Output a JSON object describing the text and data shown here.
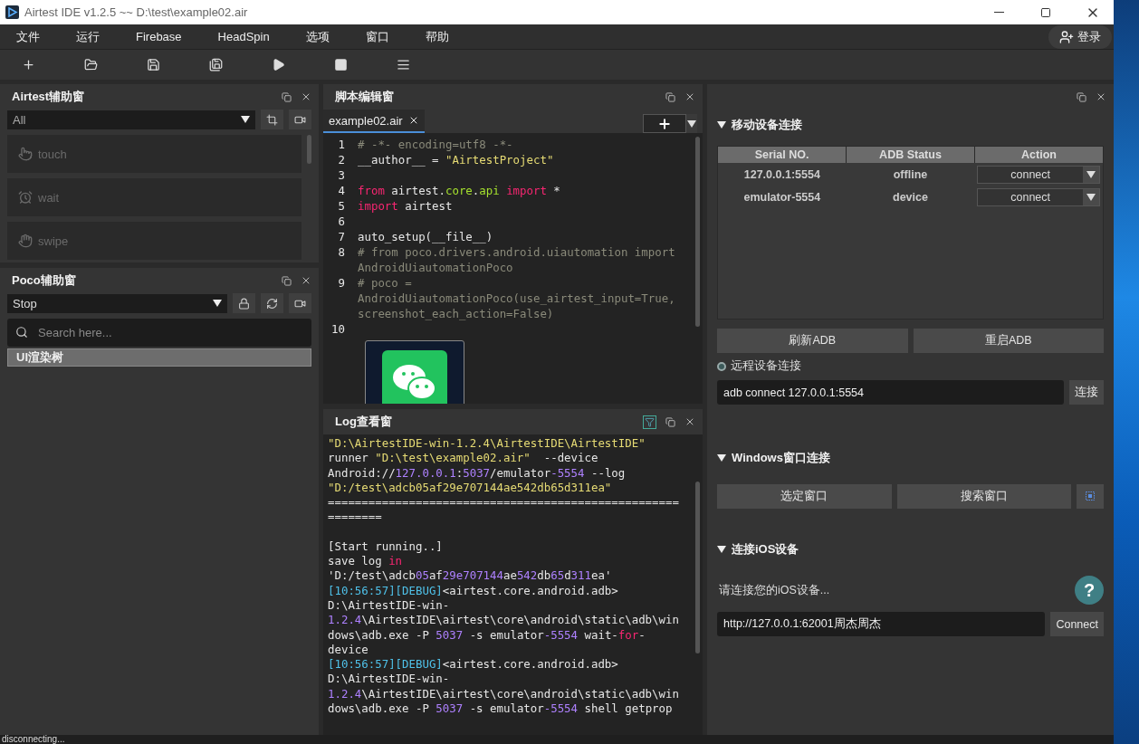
{
  "window": {
    "title": "Airtest IDE v1.2.5 ~~ D:\\test\\example02.air"
  },
  "menu": [
    "文件",
    "运行",
    "Firebase",
    "HeadSpin",
    "选项",
    "窗口",
    "帮助"
  ],
  "login": "登录",
  "airtest_panel": {
    "title": "Airtest辅助窗",
    "filter": "All",
    "actions": [
      {
        "label": "touch",
        "kind": "touch",
        "disabled": true
      },
      {
        "label": "wait",
        "kind": "wait",
        "disabled": true
      },
      {
        "label": "swipe",
        "kind": "swipe",
        "disabled": true
      }
    ]
  },
  "poco_panel": {
    "title": "Poco辅助窗",
    "mode": "Stop",
    "search": {
      "placeholder": "Search here..."
    },
    "tree": [
      {
        "label": "UI渲染树",
        "selected": true
      }
    ]
  },
  "editor": {
    "title": "脚本编辑窗",
    "tabs": [
      {
        "label": "example02.air",
        "selected": true
      }
    ],
    "lines": [
      {
        "number": "1",
        "segments": [
          {
            "text": "# -*- encoding=utf8 -*-",
            "kind": "comment"
          }
        ]
      },
      {
        "number": "2",
        "segments": [
          {
            "text": "__author__ = ",
            "kind": "plain"
          },
          {
            "text": "\"AirtestProject\"",
            "kind": "string"
          }
        ]
      },
      {
        "number": "3"
      },
      {
        "number": "4",
        "segments": [
          {
            "text": "from",
            "kind": "keyword"
          },
          {
            "text": " airtest.",
            "kind": "plain"
          },
          {
            "text": "core",
            "kind": "attr"
          },
          {
            "text": ".",
            "kind": "plain"
          },
          {
            "text": "api",
            "kind": "attr"
          },
          {
            "text": " import",
            "kind": "keyword"
          },
          {
            "text": " *",
            "kind": "plain"
          }
        ]
      },
      {
        "number": "5",
        "segments": [
          {
            "text": "import",
            "kind": "keyword"
          },
          {
            "text": " airtest",
            "kind": "plain"
          }
        ]
      },
      {
        "number": "6"
      },
      {
        "number": "7",
        "segments": [
          {
            "text": "auto_setup(__file__)",
            "kind": "plain"
          }
        ]
      },
      {
        "number": "8",
        "segments": [
          {
            "text": "# from poco.drivers.android.uiautomation import AndroidUiautomationPoco",
            "kind": "comment"
          }
        ]
      },
      {
        "number": "9",
        "segments": [
          {
            "text": "# poco = AndroidUiautomationPoco(use_airtest_input=True, screenshot_each_action=False)",
            "kind": "comment"
          }
        ]
      },
      {
        "number": "10",
        "image": true
      }
    ]
  },
  "log": {
    "title": "Log查看窗",
    "lines": [
      {
        "segments": [
          {
            "text": "\"D:\\AirtestIDE-win-1.2.4\\AirtestIDE\\AirtestIDE\"",
            "kind": "string"
          }
        ]
      },
      {
        "segments": [
          {
            "text": "runner ",
            "kind": "plain"
          },
          {
            "text": "\"D:\\test\\example02.air\"",
            "kind": "string"
          },
          {
            "text": "  --device",
            "kind": "plain"
          }
        ]
      },
      {
        "segments": [
          {
            "text": "Android://",
            "kind": "plain"
          },
          {
            "text": "127.0.0.1",
            "kind": "number"
          },
          {
            "text": ":",
            "kind": "plain"
          },
          {
            "text": "5037",
            "kind": "number"
          },
          {
            "text": "/emulator",
            "kind": "plain"
          },
          {
            "text": "-5554",
            "kind": "number"
          },
          {
            "text": " --log",
            "kind": "plain"
          }
        ]
      },
      {
        "segments": [
          {
            "text": "\"D:/test\\adcb05af29e707144ae542db65d311ea\"",
            "kind": "string"
          }
        ]
      },
      {
        "segments": [
          {
            "text": "====================================================",
            "kind": "plain"
          }
        ]
      },
      {
        "segments": [
          {
            "text": "========",
            "kind": "plain"
          }
        ],
        "blank_after": true
      },
      {
        "segments": [
          {
            "text": "[Start running..]",
            "kind": "plain"
          }
        ]
      },
      {
        "segments": [
          {
            "text": "save log ",
            "kind": "plain"
          },
          {
            "text": "in",
            "kind": "keyword"
          }
        ]
      },
      {
        "segments": [
          {
            "text": "'D:/test\\adcb",
            "kind": "plain"
          },
          {
            "text": "05",
            "kind": "number"
          },
          {
            "text": "af",
            "kind": "plain"
          },
          {
            "text": "29e707144",
            "kind": "number"
          },
          {
            "text": "ae",
            "kind": "plain"
          },
          {
            "text": "542",
            "kind": "number"
          },
          {
            "text": "db",
            "kind": "plain"
          },
          {
            "text": "65",
            "kind": "number"
          },
          {
            "text": "d",
            "kind": "plain"
          },
          {
            "text": "311",
            "kind": "number"
          },
          {
            "text": "ea'",
            "kind": "plain"
          }
        ]
      },
      {
        "segments": [
          {
            "text": "[10:56:57][DEBUG]",
            "kind": "debug"
          },
          {
            "text": "<airtest.core.android.adb>",
            "kind": "plain"
          }
        ]
      },
      {
        "segments": [
          {
            "text": "D:\\AirtestIDE-win-",
            "kind": "plain"
          }
        ]
      },
      {
        "segments": [
          {
            "text": "1.2.4",
            "kind": "number"
          },
          {
            "text": "\\AirtestIDE\\airtest\\core\\android\\static\\adb\\win",
            "kind": "plain"
          }
        ]
      },
      {
        "segments": [
          {
            "text": "dows\\adb.exe -P ",
            "kind": "plain"
          },
          {
            "text": "5037",
            "kind": "number"
          },
          {
            "text": " -s emulator",
            "kind": "plain"
          },
          {
            "text": "-5554",
            "kind": "number"
          },
          {
            "text": " wait-",
            "kind": "plain"
          },
          {
            "text": "for",
            "kind": "keyword"
          },
          {
            "text": "-",
            "kind": "plain"
          }
        ]
      },
      {
        "segments": [
          {
            "text": "device",
            "kind": "plain"
          }
        ]
      },
      {
        "segments": [
          {
            "text": "[10:56:57][DEBUG]",
            "kind": "debug"
          },
          {
            "text": "<airtest.core.android.adb>",
            "kind": "plain"
          }
        ]
      },
      {
        "segments": [
          {
            "text": "D:\\AirtestIDE-win-",
            "kind": "plain"
          }
        ]
      },
      {
        "segments": [
          {
            "text": "1.2.4",
            "kind": "number"
          },
          {
            "text": "\\AirtestIDE\\airtest\\core\\android\\static\\adb\\win",
            "kind": "plain"
          }
        ]
      },
      {
        "segments": [
          {
            "text": "dows\\adb.exe -P ",
            "kind": "plain"
          },
          {
            "text": "5037",
            "kind": "number"
          },
          {
            "text": " -s emulator",
            "kind": "plain"
          },
          {
            "text": "-5554",
            "kind": "number"
          },
          {
            "text": " shell getprop",
            "kind": "plain"
          }
        ]
      }
    ]
  },
  "devices": {
    "title": "移动设备连接",
    "expanded": true,
    "table": {
      "columns": [
        "Serial NO.",
        "ADB Status",
        "Action"
      ],
      "rows": [
        {
          "serial": "127.0.0.1:5554",
          "status": "offline",
          "action": "connect"
        },
        {
          "serial": "emulator-5554",
          "status": "device",
          "action": "connect"
        }
      ]
    },
    "buttons": [
      "刷新ADB",
      "重启ADB"
    ],
    "remote": {
      "label": "远程设备连接",
      "value": "adb connect 127.0.0.1:5554",
      "button": "连接"
    }
  },
  "windows": {
    "title": "Windows窗口连接",
    "expanded": true,
    "buttons": [
      "选定窗口",
      "搜索窗口"
    ]
  },
  "ios": {
    "title": "连接iOS设备",
    "expanded": true,
    "hint": "请连接您的iOS设备...",
    "help": "?",
    "value": "http://127.0.0.1:62001周杰周杰",
    "button": "Connect"
  },
  "status_bar": "disconnecting..."
}
